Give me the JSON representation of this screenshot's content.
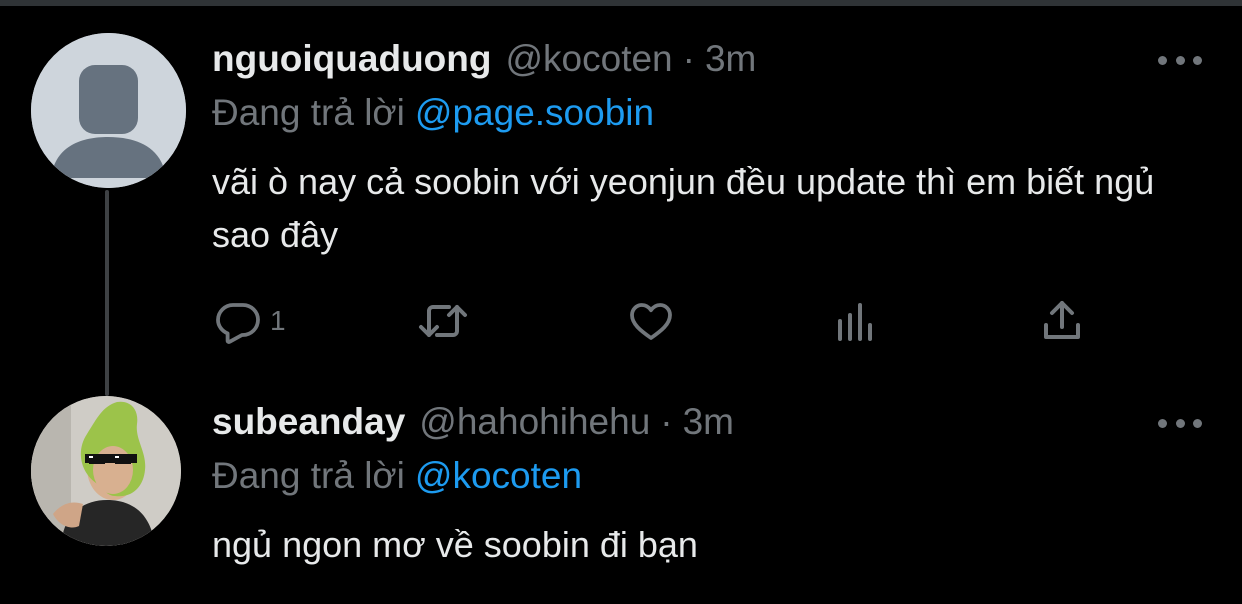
{
  "colors": {
    "background": "#000000",
    "text": "#e7e9ea",
    "secondary": "#71767b",
    "mention": "#1d9bf0",
    "thread_line": "#3e4144"
  },
  "tweets": [
    {
      "display_name": "nguoiquaduong",
      "handle": "@kocoten",
      "separator": "·",
      "time": "3m",
      "reply_prefix": "Đang trả lời",
      "reply_to": "@page.soobin",
      "text": "vãi ò nay cả soobin với yeonjun đều update thì em biết ngủ sao đây",
      "avatar": "default-avatar-icon",
      "actions": {
        "reply_count": "1"
      }
    },
    {
      "display_name": "subeanday",
      "handle": "@hahohihehu",
      "separator": "·",
      "time": "3m",
      "reply_prefix": "Đang trả lời",
      "reply_to": "@kocoten",
      "text": "ngủ ngon mơ về soobin đi bạn",
      "avatar": "profile-photo"
    }
  ],
  "icons": [
    "reply-icon",
    "retweet-icon",
    "like-icon",
    "views-icon",
    "share-icon",
    "more-icon"
  ]
}
